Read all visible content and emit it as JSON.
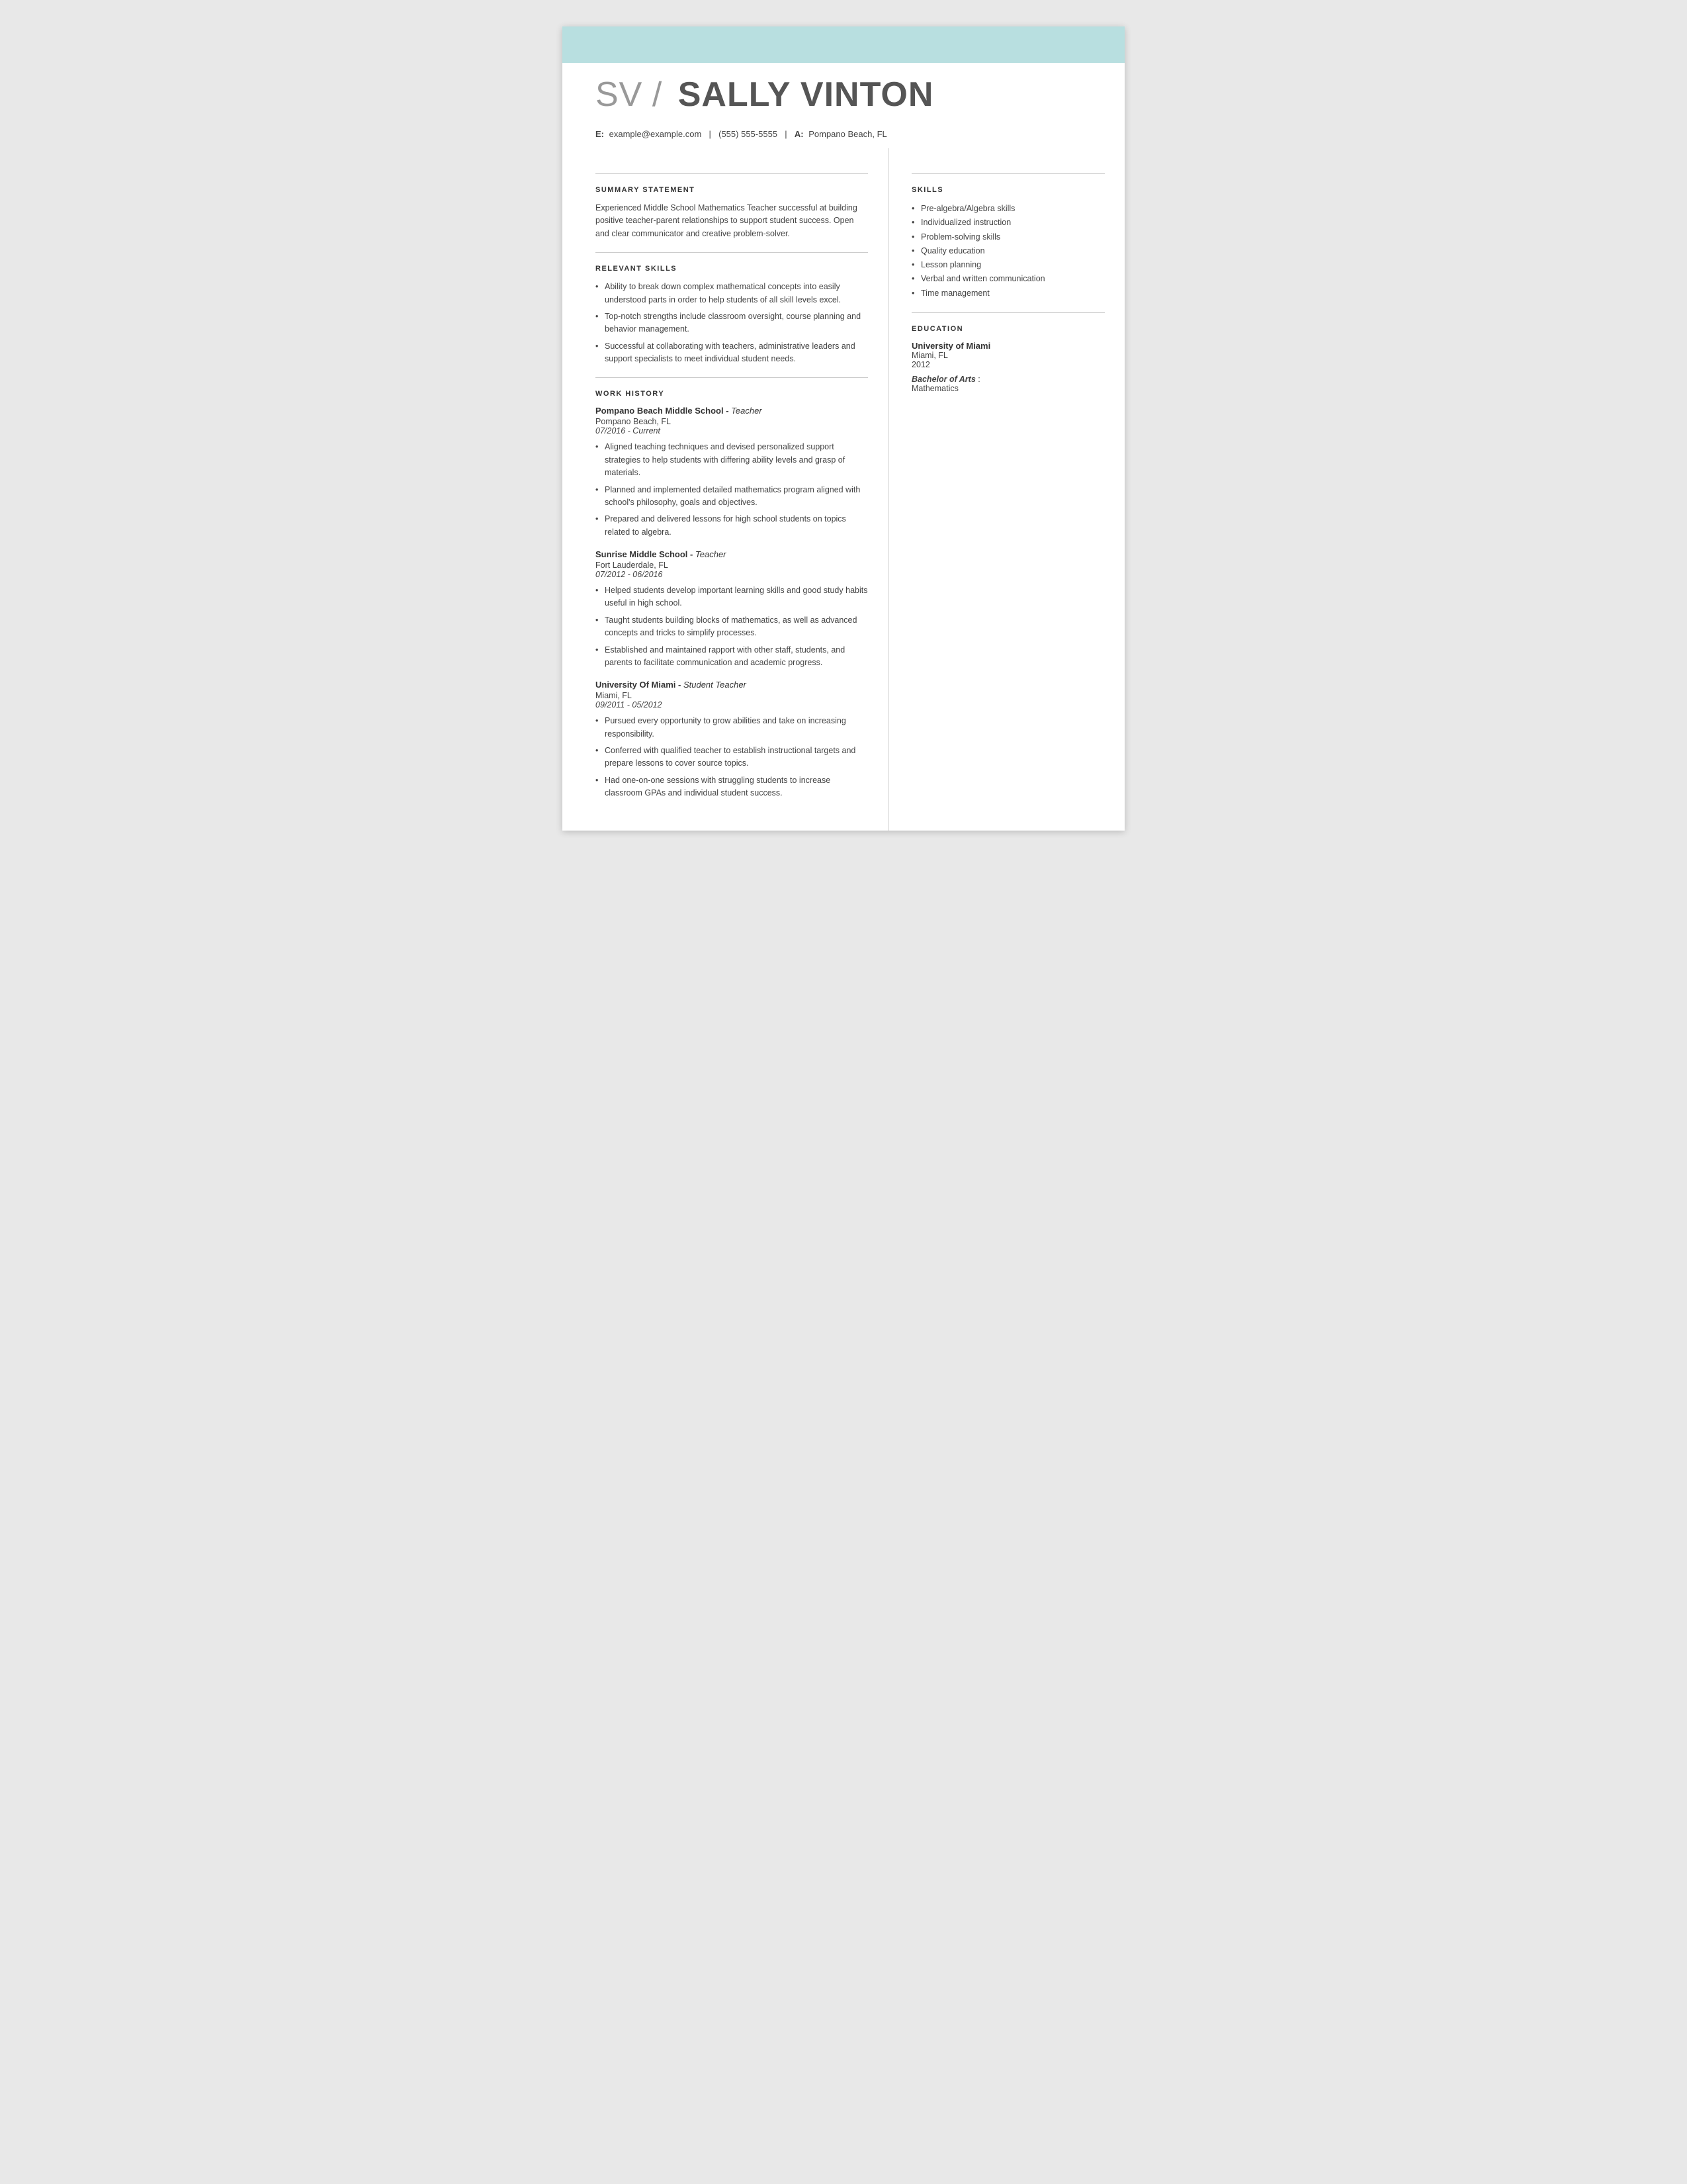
{
  "header": {
    "banner_color": "#b8dfe0",
    "initials": "SV",
    "separator": "/",
    "fullname": "SALLY VINTON",
    "contact": {
      "email_label": "E:",
      "email": "example@example.com",
      "phone": "(555) 555-5555",
      "address_label": "A:",
      "address": "Pompano Beach, FL"
    }
  },
  "left": {
    "summary": {
      "title": "SUMMARY STATEMENT",
      "body": "Experienced Middle School Mathematics Teacher successful at building positive teacher-parent relationships to support student success. Open and clear communicator and creative problem-solver."
    },
    "relevant_skills": {
      "title": "RELEVANT SKILLS",
      "items": [
        "Ability to break down complex mathematical concepts into easily understood parts in order to help students of all skill levels excel.",
        "Top-notch strengths include classroom oversight, course planning and behavior management.",
        "Successful at collaborating with teachers, administrative leaders and support specialists to meet individual student needs."
      ]
    },
    "work_history": {
      "title": "WORK HISTORY",
      "jobs": [
        {
          "company": "Pompano Beach Middle School",
          "role": "Teacher",
          "location": "Pompano Beach, FL",
          "dates": "07/2016 - Current",
          "bullets": [
            "Aligned teaching techniques and devised personalized support strategies to help students with differing ability levels and grasp of materials.",
            "Planned and implemented detailed mathematics program aligned with school's philosophy, goals and objectives.",
            "Prepared and delivered lessons for high school students on topics related to algebra."
          ]
        },
        {
          "company": "Sunrise Middle School",
          "role": "Teacher",
          "location": "Fort Lauderdale, FL",
          "dates": "07/2012 - 06/2016",
          "bullets": [
            "Helped students develop important learning skills and good study habits useful in high school.",
            "Taught students building blocks of mathematics, as well as advanced concepts and tricks to simplify processes.",
            "Established and maintained rapport with other staff, students, and parents to facilitate communication and academic progress."
          ]
        },
        {
          "company": "University Of Miami",
          "role": "Student Teacher",
          "location": "Miami, FL",
          "dates": "09/2011 - 05/2012",
          "bullets": [
            "Pursued every opportunity to grow abilities and take on increasing responsibility.",
            "Conferred with qualified teacher to establish instructional targets and prepare lessons to cover source topics.",
            "Had one-on-one sessions with struggling students to increase classroom GPAs and individual student success."
          ]
        }
      ]
    }
  },
  "right": {
    "skills": {
      "title": "SKILLS",
      "items": [
        "Pre-algebra/Algebra skills",
        "Individualized instruction",
        "Problem-solving skills",
        "Quality education",
        "Lesson planning",
        "Verbal and written communication",
        "Time management"
      ]
    },
    "education": {
      "title": "EDUCATION",
      "entries": [
        {
          "institution": "University of Miami",
          "location": "Miami, FL",
          "year": "2012",
          "degree": "Bachelor of Arts",
          "field": "Mathematics"
        }
      ]
    }
  }
}
